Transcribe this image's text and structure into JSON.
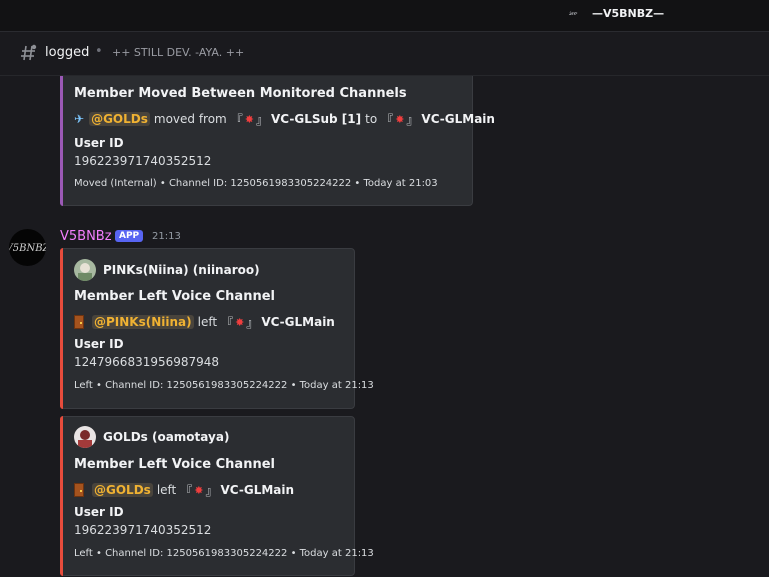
{
  "server": {
    "name": "—V5BNBZ—"
  },
  "channel": {
    "name": "logged",
    "topic": "++ STILL DEV. -AYA. ++"
  },
  "message_top": {
    "embed": {
      "title": "Member Moved Between Monitored Channels",
      "line_mention": "@GOLDs",
      "line_verb": "moved from",
      "from_channel": "VC-GLSub [1]",
      "to_word": "to",
      "to_channel": "VC-GLMain",
      "field_name": "User ID",
      "field_value": "196223971740352512",
      "footer": "Moved (Internal) • Channel ID: 1250561983305224222 • Today at 21:03"
    }
  },
  "message_bot": {
    "author": "V5BNBz",
    "badge": "APP",
    "time": "21:13",
    "embeds": [
      {
        "author": "PINKs(Niina) (niinaroo)",
        "title": "Member Left Voice Channel",
        "mention": "@PINKs(Niina)",
        "verb": "left",
        "channel": "VC-GLMain",
        "field_name": "User ID",
        "field_value": "1247966831956987948",
        "footer": "Left • Channel ID: 1250561983305224222 • Today at 21:13"
      },
      {
        "author": "GOLDs (oamotaya)",
        "title": "Member Left Voice Channel",
        "mention": "@GOLDs",
        "verb": "left",
        "channel": "VC-GLMain",
        "field_name": "User ID",
        "field_value": "196223971740352512",
        "footer": "Left • Channel ID: 1250561983305224222 • Today at 21:13"
      }
    ]
  },
  "colors": {
    "moved_bar": "#9b59b6",
    "left_bar": "#e74c3c",
    "mention": "#f0b232",
    "bot_name": "#f47fff",
    "app_badge": "#5865f2"
  },
  "icons": [
    "server-logo-icon",
    "channel-hash-icon",
    "airplane-icon",
    "door-icon",
    "collision-icon"
  ]
}
